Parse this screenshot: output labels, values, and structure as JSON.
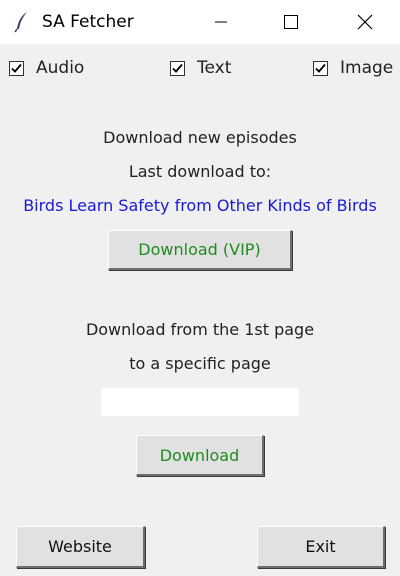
{
  "window": {
    "title": "SA Fetcher",
    "icon": "feather-icon"
  },
  "options": {
    "audio": {
      "label": "Audio",
      "checked": true
    },
    "text": {
      "label": "Text",
      "checked": true
    },
    "image": {
      "label": "Image",
      "checked": true
    }
  },
  "new_episodes": {
    "heading": "Download new episodes",
    "last_label": "Last download to:",
    "last_title": "Birds Learn Safety from Other Kinds of Birds",
    "button": "Download (VIP)"
  },
  "range_download": {
    "line1": "Download from the 1st page",
    "line2": "to a specific page",
    "input_value": "",
    "button": "Download"
  },
  "footer": {
    "website": "Website",
    "exit": "Exit"
  },
  "colors": {
    "link": "#1a1ad8",
    "green_text": "#1f8c1f",
    "background": "#f0f0f0"
  }
}
